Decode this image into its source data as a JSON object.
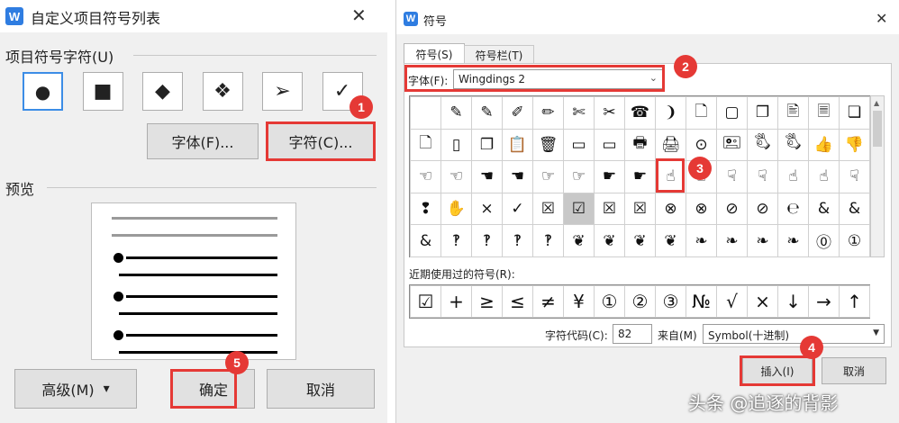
{
  "left": {
    "title": "自定义项目符号列表",
    "close_glyph": "✕",
    "group_label": "项目符号字符(U)",
    "bullets": [
      "●",
      "■",
      "◆",
      "❖",
      "➢",
      "✓"
    ],
    "font_button": "字体(F)...",
    "char_button": "字符(C)...",
    "preview_label": "预览",
    "advanced_button": "高级(M)",
    "advanced_arrow": "▾",
    "ok_button": "确定",
    "cancel_button": "取消"
  },
  "right": {
    "title": "符号",
    "close_glyph": "✕",
    "tabs": [
      "符号(S)",
      "符号栏(T)"
    ],
    "font_label": "字体(F):",
    "font_value": "Wingdings 2",
    "grid": [
      [
        "",
        "✎",
        "✎",
        "✐",
        "✏",
        "✄",
        "✂",
        "☎",
        "❩",
        "🗋",
        "▢",
        "❐",
        "🖹",
        "🗏",
        "❏"
      ],
      [
        "🗋",
        "▯",
        "❐",
        "📋",
        "🗑",
        "▭",
        "▭",
        "🖶",
        "🖨",
        "⊙",
        "🖭",
        "🖏",
        "🖏",
        "👍",
        "👎"
      ],
      [
        "☜",
        "☜",
        "☚",
        "☚",
        "☞",
        "☞",
        "☛",
        "☛",
        "☝",
        "☝",
        "☟",
        "☟",
        "☝",
        "☝",
        "☟"
      ],
      [
        "❢",
        "✋",
        "×",
        "✓",
        "☒",
        "☑",
        "☒",
        "☒",
        "⊗",
        "⊗",
        "⊘",
        "⊘",
        "℮",
        "&",
        "&"
      ],
      [
        "&",
        "‽",
        "‽",
        "‽",
        "‽",
        "❦",
        "❦",
        "❦",
        "❦",
        "❧",
        "❧",
        "❧",
        "❧",
        "⓪",
        "①"
      ]
    ],
    "recent_label": "近期使用过的符号(R):",
    "recent": [
      "☑",
      "+",
      "≥",
      "≤",
      "≠",
      "¥",
      "①",
      "②",
      "③",
      "№",
      "√",
      "×",
      "↓",
      "→",
      "↑"
    ],
    "code_label": "字符代码(C):",
    "code_value": "82",
    "from_label": "来自(M)",
    "from_value": "Symbol(十进制)",
    "insert_button": "插入(I)",
    "cancel_button": "取消"
  },
  "badges": [
    "1",
    "2",
    "3",
    "4",
    "5"
  ],
  "watermark": "头条 @追逐的背影"
}
